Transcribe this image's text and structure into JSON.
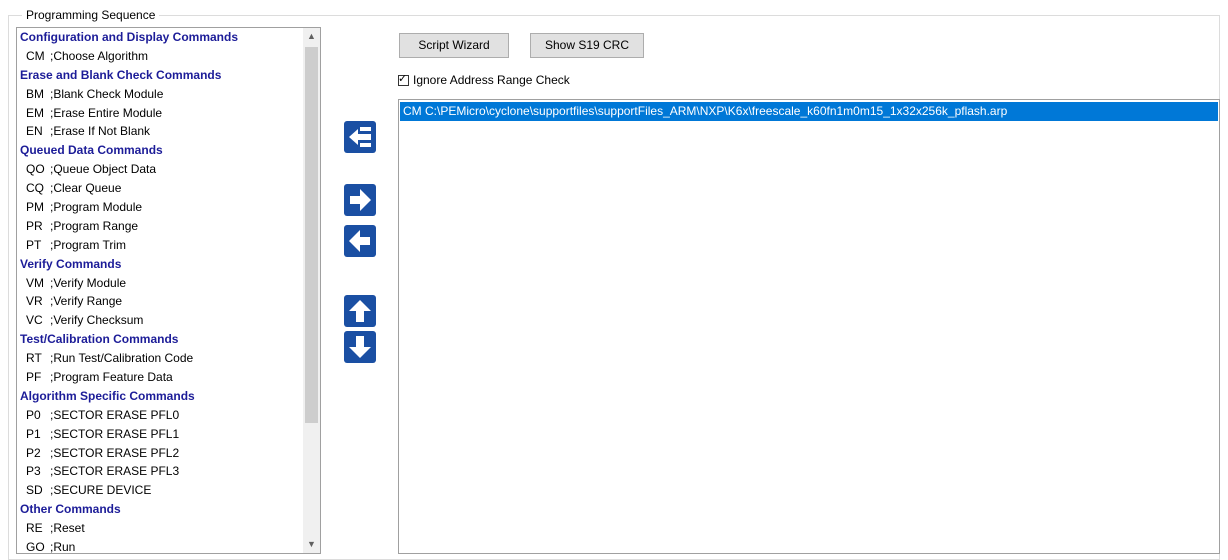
{
  "group": {
    "title": "Programming Sequence"
  },
  "commands": [
    {
      "kind": "header",
      "text": "Configuration and Display Commands"
    },
    {
      "kind": "item",
      "code": "CM",
      "desc": ";Choose Algorithm"
    },
    {
      "kind": "header",
      "text": "Erase and Blank Check Commands"
    },
    {
      "kind": "item",
      "code": "BM",
      "desc": ";Blank Check Module"
    },
    {
      "kind": "item",
      "code": "EM",
      "desc": ";Erase Entire Module"
    },
    {
      "kind": "item",
      "code": "EN",
      "desc": ";Erase If Not Blank"
    },
    {
      "kind": "header",
      "text": "Queued Data Commands"
    },
    {
      "kind": "item",
      "code": "QO",
      "desc": ";Queue Object Data"
    },
    {
      "kind": "item",
      "code": "CQ",
      "desc": ";Clear Queue"
    },
    {
      "kind": "item",
      "code": "PM",
      "desc": ";Program Module"
    },
    {
      "kind": "item",
      "code": "PR",
      "desc": ";Program Range"
    },
    {
      "kind": "item",
      "code": "PT",
      "desc": ";Program Trim"
    },
    {
      "kind": "header",
      "text": "Verify Commands"
    },
    {
      "kind": "item",
      "code": "VM",
      "desc": ";Verify Module"
    },
    {
      "kind": "item",
      "code": "VR",
      "desc": ";Verify Range"
    },
    {
      "kind": "item",
      "code": "VC",
      "desc": ";Verify Checksum"
    },
    {
      "kind": "header",
      "text": "Test/Calibration Commands"
    },
    {
      "kind": "item",
      "code": "RT",
      "desc": ";Run Test/Calibration Code"
    },
    {
      "kind": "item",
      "code": "PF",
      "desc": ";Program Feature Data"
    },
    {
      "kind": "header",
      "text": "Algorithm Specific Commands"
    },
    {
      "kind": "item",
      "code": "P0",
      "desc": ";SECTOR ERASE PFL0"
    },
    {
      "kind": "item",
      "code": "P1",
      "desc": ";SECTOR ERASE PFL1"
    },
    {
      "kind": "item",
      "code": "P2",
      "desc": ";SECTOR ERASE PFL2"
    },
    {
      "kind": "item",
      "code": "P3",
      "desc": ";SECTOR ERASE PFL3"
    },
    {
      "kind": "item",
      "code": "SD",
      "desc": ";SECURE DEVICE"
    },
    {
      "kind": "header",
      "text": "Other Commands"
    },
    {
      "kind": "item",
      "code": "RE",
      "desc": ";Reset"
    },
    {
      "kind": "item",
      "code": "GO",
      "desc": ";Run"
    }
  ],
  "buttons": {
    "script_wizard": "Script Wizard",
    "show_crc": "Show S19 CRC"
  },
  "ignore_range": {
    "label": "Ignore Address Range Check",
    "checked": true
  },
  "script": {
    "lines": [
      "CM  C:\\PEMicro\\cyclone\\supportfiles\\supportFiles_ARM\\NXP\\K6x\\freescale_k60fn1m0m15_1x32x256k_pflash.arp"
    ]
  },
  "arrow_icons": [
    "insert-left-icon",
    "arrow-right-icon",
    "arrow-left-icon",
    "arrow-up-icon",
    "arrow-down-icon"
  ],
  "colors": {
    "header_text": "#1c1c98",
    "arrow_button": "#1a4fa3",
    "selection": "#0078d7"
  }
}
